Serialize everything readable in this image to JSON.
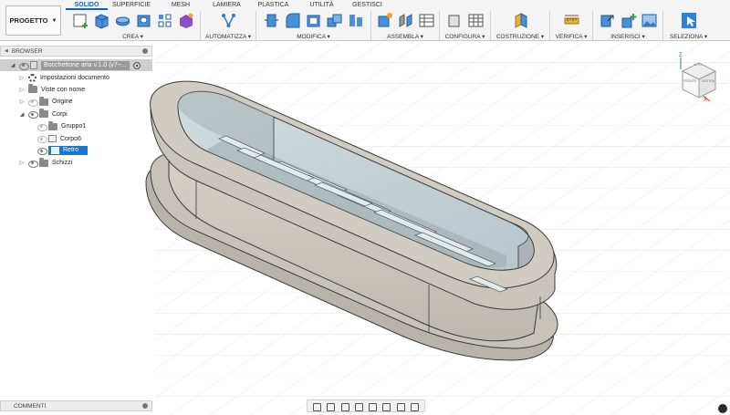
{
  "workspace": {
    "label": "PROGETTO"
  },
  "tabs": [
    {
      "label": "SOLIDO",
      "active": true
    },
    {
      "label": "SUPERFICIE",
      "active": false
    },
    {
      "label": "MESH",
      "active": false
    },
    {
      "label": "LAMIERA",
      "active": false
    },
    {
      "label": "PLASTICA",
      "active": false
    },
    {
      "label": "UTILITÀ",
      "active": false
    },
    {
      "label": "GESTISCI",
      "active": false
    }
  ],
  "ribbon": [
    {
      "label": "CREA ▾",
      "icons": [
        "new-sketch-icon",
        "extrude-icon",
        "revolve-icon",
        "hole-icon",
        "rectangular-pattern-icon",
        "create-form-icon"
      ]
    },
    {
      "label": "AUTOMATIZZA ▾",
      "icons": [
        "automate-icon"
      ]
    },
    {
      "label": "MODIFICA ▾",
      "icons": [
        "press-pull-icon",
        "fillet-icon",
        "shell-icon",
        "combine-icon",
        "align-icon"
      ]
    },
    {
      "label": "ASSEMBLA ▾",
      "icons": [
        "new-component-icon",
        "joint-icon",
        "as-built-joint-icon"
      ]
    },
    {
      "label": "CONFIGURA ▾",
      "icons": [
        "configure-icon",
        "table-icon"
      ]
    },
    {
      "label": "COSTRUZIONE ▾",
      "icons": [
        "offset-plane-icon"
      ]
    },
    {
      "label": "VERIFICA ▾",
      "icons": [
        "measure-icon"
      ]
    },
    {
      "label": "INSERISCI ▾",
      "icons": [
        "insert-derive-icon",
        "insert-mesh-icon",
        "insert-image-icon"
      ]
    },
    {
      "label": "SELEZIONA ▾",
      "icons": [
        "select-icon"
      ]
    }
  ],
  "browser": {
    "title": "BROWSER",
    "items": [
      {
        "label": "Bocchettone aria v.1.0 (v7~...",
        "kind": "root"
      },
      {
        "label": "Impostazioni documento",
        "kind": "settings"
      },
      {
        "label": "Viste con nome",
        "kind": "folder"
      },
      {
        "label": "Origine",
        "kind": "folder"
      },
      {
        "label": "Corpi",
        "kind": "folder"
      },
      {
        "label": "Gruppo1",
        "kind": "folder"
      },
      {
        "label": "Corpo6",
        "kind": "body"
      },
      {
        "label": "Retro",
        "kind": "body",
        "selected": true
      },
      {
        "label": "Schizzi",
        "kind": "folder"
      }
    ]
  },
  "comments": {
    "title": "COMMENTI"
  },
  "viewcube": {
    "x_label": "X",
    "z_label": "Z",
    "front": "FRONTE",
    "right": "DESTRA",
    "top": "ALTO"
  },
  "colors": {
    "accent": "#0a64c8",
    "selected_row": "#1875d0",
    "part": "#cbc7bf",
    "part_edge": "#3a3a3a"
  }
}
